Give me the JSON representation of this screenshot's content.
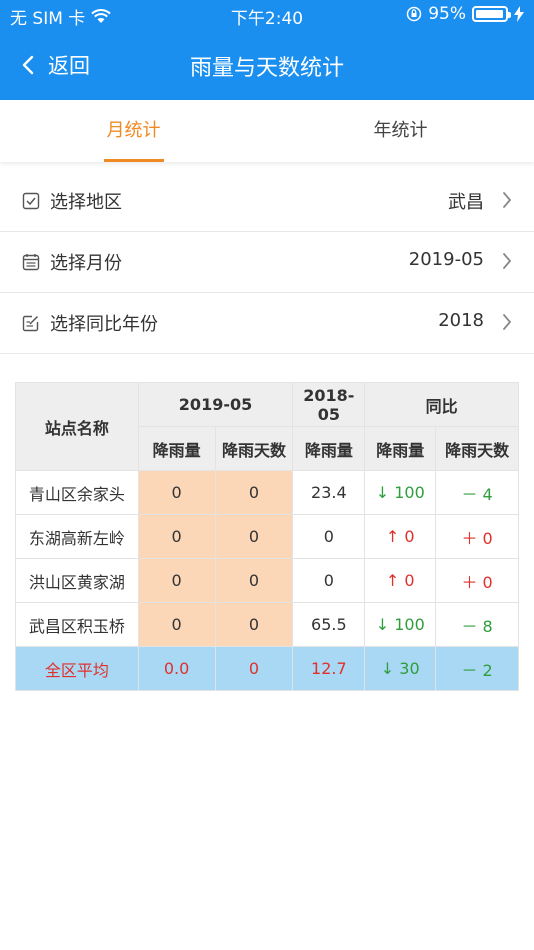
{
  "status_bar": {
    "carrier": "无 SIM 卡",
    "time": "下午2:40",
    "battery": "95%",
    "battery_level": 0.95
  },
  "nav": {
    "back_label": "返回",
    "title": "雨量与天数统计"
  },
  "tabs": [
    {
      "label": "月统计",
      "active": true
    },
    {
      "label": "年统计",
      "active": false
    }
  ],
  "filters": {
    "region": {
      "label": "选择地区",
      "value": "武昌"
    },
    "month": {
      "label": "选择月份",
      "value": "2019-05"
    },
    "compare_year": {
      "label": "选择同比年份",
      "value": "2018"
    }
  },
  "table": {
    "header": {
      "station": "站点名称",
      "current": "2019-05",
      "previous": "2018-05",
      "yoy": "同比",
      "rain": "降雨量",
      "rain_days": "降雨天数",
      "prev_rain": "降雨量",
      "yoy_rain": "降雨量",
      "yoy_days": "降雨天数"
    },
    "rows": [
      {
        "name": "青山区余家头",
        "rain": "0",
        "days": "0",
        "prev": "23.4",
        "yoy_rain": "↓ 100",
        "yoy_days": "－ 4"
      },
      {
        "name": "东湖高新左岭",
        "rain": "0",
        "days": "0",
        "prev": "0",
        "yoy_rain": "↑ 0",
        "yoy_days": "＋ 0"
      },
      {
        "name": "洪山区黄家湖",
        "rain": "0",
        "days": "0",
        "prev": "0",
        "yoy_rain": "↑ 0",
        "yoy_days": "＋ 0"
      },
      {
        "name": "武昌区积玉桥",
        "rain": "0",
        "days": "0",
        "prev": "65.5",
        "yoy_rain": "↓ 100",
        "yoy_days": "－ 8"
      }
    ],
    "average": {
      "name": "全区平均",
      "rain": "0.0",
      "days": "0",
      "prev": "12.7",
      "yoy_rain": "↓ 30",
      "yoy_days": "－ 2"
    }
  },
  "colors": {
    "header_bg": "#1a8ff0",
    "accent": "#f08a24",
    "peach": "#fbd7b8",
    "average_row": "#a9d8f5",
    "up_red": "#e0302b",
    "down_green": "#2f9e3c"
  }
}
